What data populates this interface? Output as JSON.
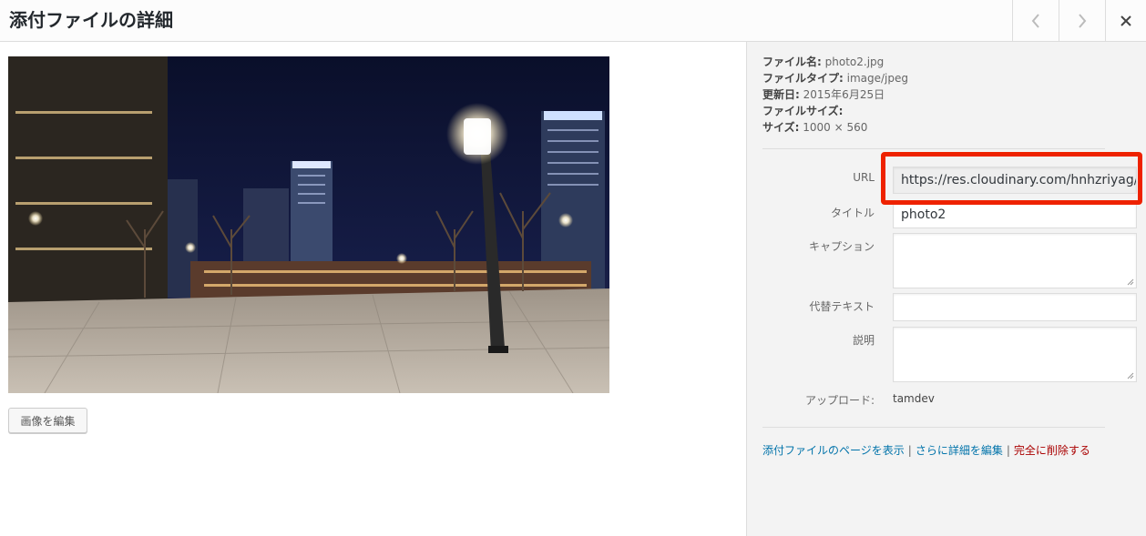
{
  "header": {
    "title": "添付ファイルの詳細"
  },
  "media": {
    "edit_button": "画像を編集"
  },
  "details": {
    "filename_label": "ファイル名:",
    "filename": "photo2.jpg",
    "filetype_label": "ファイルタイプ:",
    "filetype": "image/jpeg",
    "uploaded_label": "更新日:",
    "uploaded": "2015年6月25日",
    "filesize_label": "ファイルサイズ:",
    "filesize": "",
    "dimensions_label": "サイズ:",
    "dimensions": "1000 × 560"
  },
  "form": {
    "url_label": "URL",
    "url_value": "https://res.cloudinary.com/hnhzriyag/i",
    "title_label": "タイトル",
    "title_value": "photo2",
    "caption_label": "キャプション",
    "caption_value": "",
    "alt_label": "代替テキスト",
    "alt_value": "",
    "description_label": "説明",
    "description_value": "",
    "uploaded_by_label": "アップロード:",
    "uploaded_by": "tamdev"
  },
  "actions": {
    "view_page": "添付ファイルのページを表示",
    "edit_more": "さらに詳細を編集",
    "delete": "完全に削除する",
    "separator": "|"
  },
  "colors": {
    "link": "#0073aa",
    "delete": "#aa0000",
    "highlight": "#ee2200"
  }
}
